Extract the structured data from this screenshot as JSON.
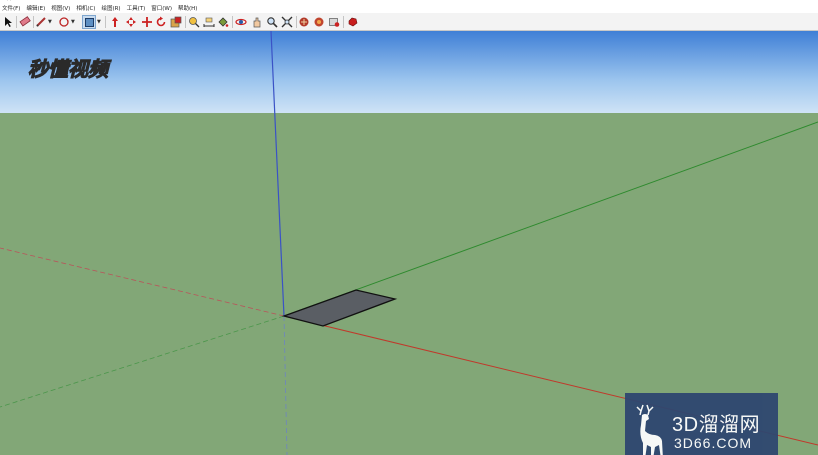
{
  "menu": [
    {
      "label": "文件(F)"
    },
    {
      "label": "编辑(E)"
    },
    {
      "label": "视图(V)"
    },
    {
      "label": "相机(C)"
    },
    {
      "label": "绘图(R)"
    },
    {
      "label": "工具(T)"
    },
    {
      "label": "窗口(W)"
    },
    {
      "label": "帮助(H)"
    }
  ],
  "toolbar": {
    "tools": [
      {
        "icon": "select-arrow-icon",
        "pressed": false
      },
      {
        "icon": "eraser-icon",
        "pressed": false
      },
      {
        "icon": "pencil-line-icon",
        "pressed": false,
        "dropdown": true
      },
      {
        "icon": "shapes-icon",
        "pressed": false,
        "dropdown": true
      },
      {
        "icon": "rectangle-icon",
        "pressed": true,
        "dropdown": true
      },
      {
        "icon": "push-pull-icon",
        "pressed": false
      },
      {
        "icon": "move-icon",
        "pressed": false
      },
      {
        "icon": "move-cross-icon",
        "pressed": false
      },
      {
        "icon": "rotate-icon",
        "pressed": false
      },
      {
        "icon": "scale-icon",
        "pressed": false
      },
      {
        "icon": "tape-measure-icon",
        "pressed": false
      },
      {
        "icon": "dimension-icon",
        "pressed": false
      },
      {
        "icon": "paint-bucket-icon",
        "pressed": false
      },
      {
        "icon": "orbit-icon",
        "pressed": false
      },
      {
        "icon": "pan-icon",
        "pressed": false
      },
      {
        "icon": "zoom-icon",
        "pressed": false
      },
      {
        "icon": "zoom-extents-icon",
        "pressed": false
      },
      {
        "icon": "warehouse-icon",
        "pressed": false
      },
      {
        "icon": "components-icon",
        "pressed": false
      },
      {
        "icon": "extension-icon",
        "pressed": false
      },
      {
        "icon": "ruby-icon",
        "pressed": false
      }
    ]
  },
  "logo_text": "秒懂视频",
  "watermark": {
    "line1": "3D溜溜网",
    "line2": "3D66.COM"
  },
  "colors": {
    "sky_top": "#3f7fd6",
    "sky_bottom": "#cfe3f6",
    "ground": "#82a777",
    "axis_blue": "#3a52c6",
    "axis_red": "#c0392b",
    "axis_green": "#2e8a2e",
    "face": "#5a5e64",
    "pressed": "#c9dcef",
    "watermark_bg": "#2e4670"
  }
}
